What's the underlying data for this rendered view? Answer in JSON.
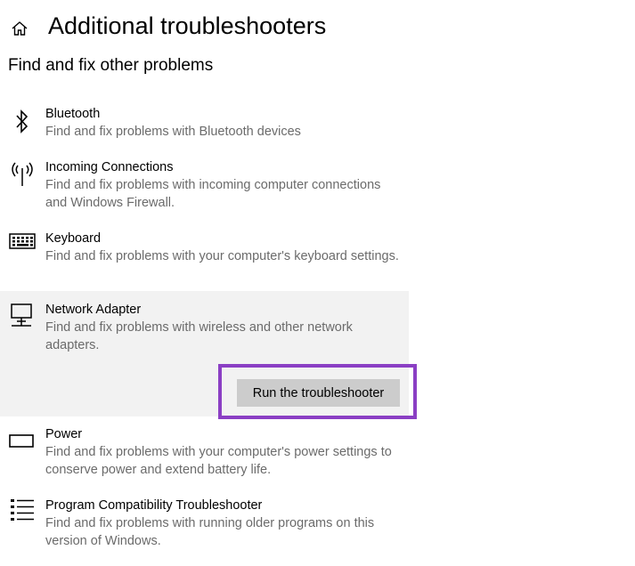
{
  "header": {
    "home_icon": "home-icon",
    "title": "Additional troubleshooters"
  },
  "section": {
    "title": "Find and fix other problems"
  },
  "items": [
    {
      "icon": "bluetooth-icon",
      "name": "Bluetooth",
      "description": "Find and fix problems with Bluetooth devices"
    },
    {
      "icon": "incoming-connections-icon",
      "name": "Incoming Connections",
      "description": "Find and fix problems with incoming computer connections and Windows Firewall."
    },
    {
      "icon": "keyboard-icon",
      "name": "Keyboard",
      "description": "Find and fix problems with your computer's keyboard settings."
    },
    {
      "icon": "network-adapter-icon",
      "name": "Network Adapter",
      "description": "Find and fix problems with wireless and other network adapters.",
      "selected": true
    },
    {
      "icon": "power-icon",
      "name": "Power",
      "description": "Find and fix problems with your computer's power settings to conserve power and extend battery life."
    },
    {
      "icon": "program-compatibility-icon",
      "name": "Program Compatibility Troubleshooter",
      "description": "Find and fix problems with running older programs on this version of Windows."
    }
  ],
  "run_button": {
    "label": "Run the troubleshooter"
  },
  "colors": {
    "highlight_border": "#8b3fc4",
    "selected_background": "#f2f2f2",
    "button_background": "#cccccc",
    "description_text": "#6b6b6b"
  }
}
